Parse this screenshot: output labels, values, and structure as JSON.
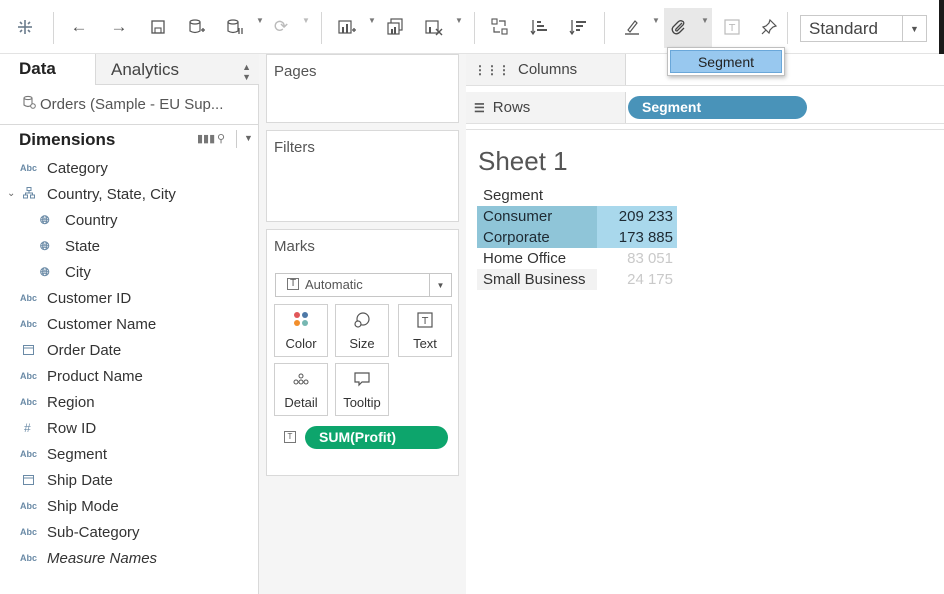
{
  "toolbar": {
    "standard_label": "Standard"
  },
  "popup": {
    "item": "Segment"
  },
  "data_pane": {
    "tab_data": "Data",
    "tab_analytics": "Analytics",
    "datasource": "Orders (Sample - EU Sup...",
    "dimensions_title": "Dimensions",
    "fields": [
      {
        "name": "Category",
        "icon": "Abc"
      },
      {
        "name": "Country, State, City",
        "icon": "hierarchy"
      },
      {
        "name": "Country",
        "icon": "globe"
      },
      {
        "name": "State",
        "icon": "globe"
      },
      {
        "name": "City",
        "icon": "globe"
      },
      {
        "name": "Customer ID",
        "icon": "Abc"
      },
      {
        "name": "Customer Name",
        "icon": "Abc"
      },
      {
        "name": "Order Date",
        "icon": "calendar"
      },
      {
        "name": "Product Name",
        "icon": "Abc"
      },
      {
        "name": "Region",
        "icon": "Abc"
      },
      {
        "name": "Row ID",
        "icon": "#"
      },
      {
        "name": "Segment",
        "icon": "Abc"
      },
      {
        "name": "Ship Date",
        "icon": "calendar"
      },
      {
        "name": "Ship Mode",
        "icon": "Abc"
      },
      {
        "name": "Sub-Category",
        "icon": "Abc"
      },
      {
        "name": "Measure Names",
        "icon": "Abc"
      }
    ],
    "icon_abc": "Abc"
  },
  "cards": {
    "pages": "Pages",
    "filters": "Filters",
    "marks": "Marks",
    "marks_type": "Automatic",
    "buttons": {
      "color": "Color",
      "size": "Size",
      "text": "Text",
      "detail": "Detail",
      "tooltip": "Tooltip"
    },
    "measure_pill": "SUM(Profit)"
  },
  "shelves": {
    "columns_label": "Columns",
    "rows_label": "Rows",
    "rows_pill": "Segment"
  },
  "sheet": {
    "title": "Sheet 1",
    "header": "Segment",
    "rows": [
      {
        "segment": "Consumer",
        "value": "209 233",
        "selected": true
      },
      {
        "segment": "Corporate",
        "value": "173 885",
        "selected": true
      },
      {
        "segment": "Home Office",
        "value": "83 051",
        "selected": false
      },
      {
        "segment": "Small Business",
        "value": "24 175",
        "selected": false
      }
    ]
  },
  "colors": {
    "green_pill": "#0da56c",
    "blue_pill": "#4993b9",
    "highlight_dark": "#8fc5d8",
    "highlight_light": "#a9d8ec",
    "popup_select": "#98c8ef"
  }
}
